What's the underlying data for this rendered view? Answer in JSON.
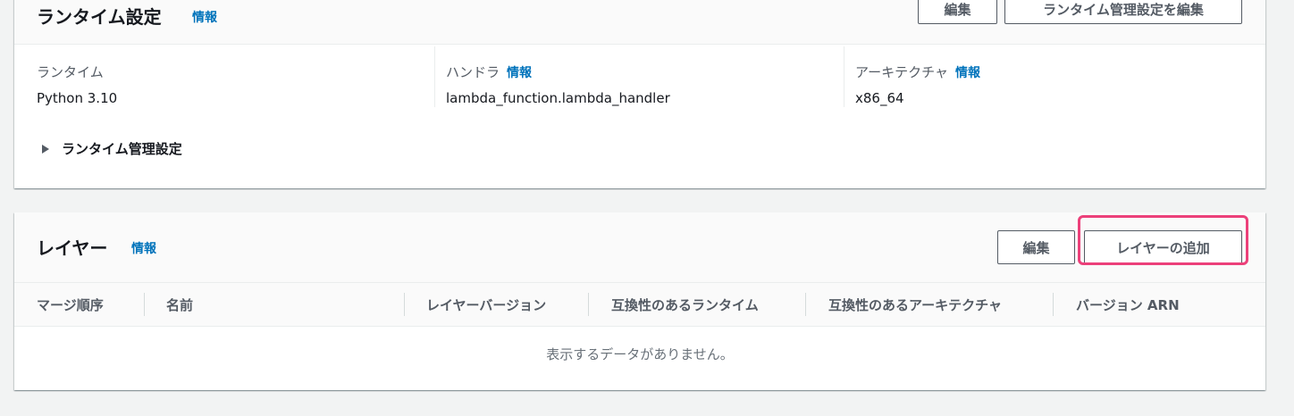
{
  "runtime_settings": {
    "title": "ランタイム設定",
    "info_link": "情報",
    "edit_button": "編集",
    "edit_runtime_management_button": "ランタイム管理設定を編集",
    "columns": [
      {
        "label": "ランタイム",
        "info_link": "",
        "value": "Python 3.10"
      },
      {
        "label": "ハンドラ",
        "info_link": "情報",
        "value": "lambda_function.lambda_handler"
      },
      {
        "label": "アーキテクチャ",
        "info_link": "情報",
        "value": "x86_64"
      }
    ],
    "runtime_management_expander": "ランタイム管理設定"
  },
  "layers": {
    "title": "レイヤー",
    "info_link": "情報",
    "edit_button": "編集",
    "add_layer_button": "レイヤーの追加",
    "highlight_color": "#ec407a",
    "table": {
      "headers": [
        "マージ順序",
        "名前",
        "レイヤーバージョン",
        "互換性のあるランタイム",
        "互換性のあるアーキテクチャ",
        "バージョン ARN"
      ],
      "rows": [],
      "empty_message": "表示するデータがありません。"
    }
  },
  "colors": {
    "background": "#f2f3f3",
    "link": "#0073bb",
    "button_border": "#545b64",
    "text": "#16191f"
  }
}
